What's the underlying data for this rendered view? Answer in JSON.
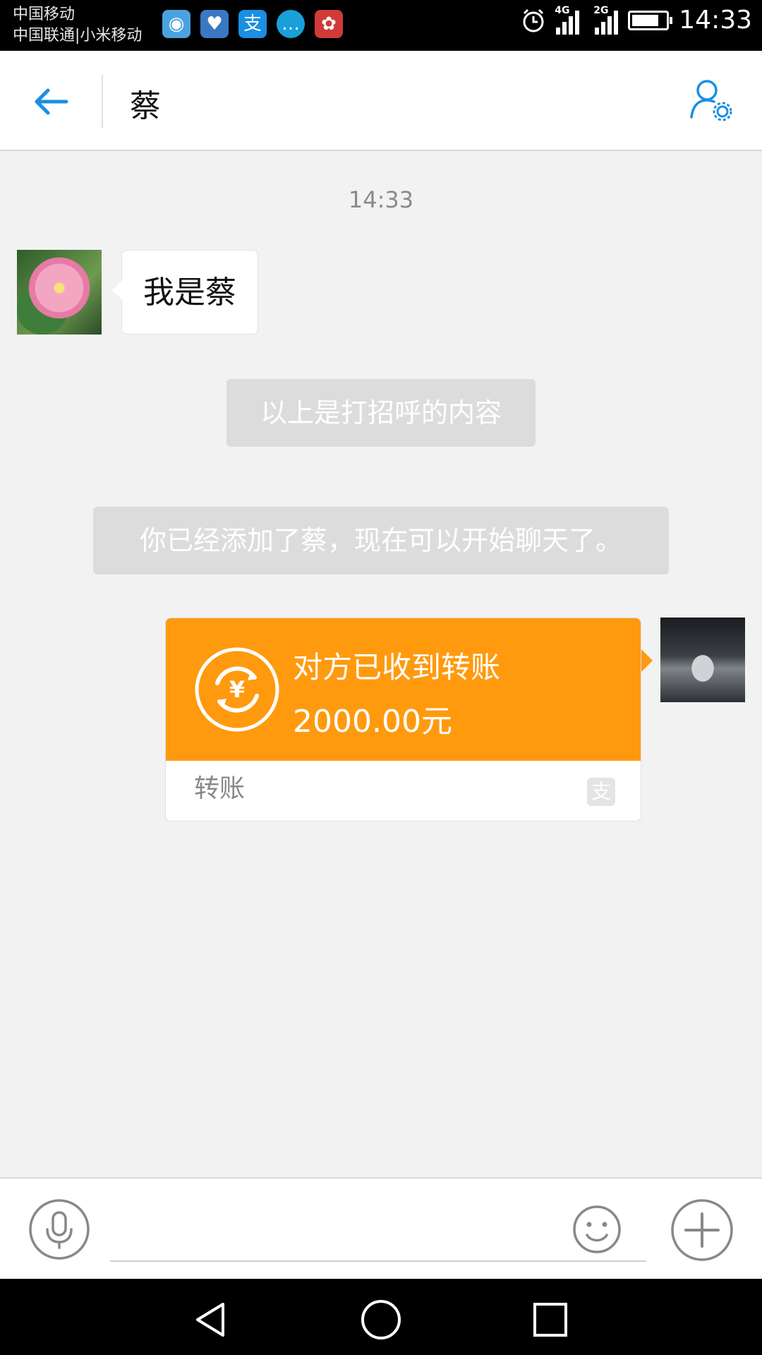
{
  "status_bar": {
    "carrier_line1": "中国移动",
    "carrier_line2": "中国联通|小米移动",
    "notification_icons": [
      "browser-icon",
      "health-icon",
      "alipay-icon",
      "message-icon",
      "huawei-icon"
    ],
    "network_1": "4G",
    "network_2": "2G",
    "battery_level": 0.8,
    "time": "14:33"
  },
  "header": {
    "title": "蔡"
  },
  "chat": {
    "timestamp": "14:33",
    "incoming_message": "我是蔡",
    "system_note_1": "以上是打招呼的内容",
    "system_note_2": "你已经添加了蔡，现在可以开始聊天了。",
    "transfer": {
      "status": "对方已收到转账",
      "amount": "2000.00元",
      "label": "转账",
      "currency_symbol": "¥"
    }
  },
  "input_bar": {
    "placeholder": "",
    "value": ""
  },
  "colors": {
    "accent": "#1a8fe3",
    "transfer_orange": "#ff9a0e",
    "background": "#f2f2f2"
  }
}
